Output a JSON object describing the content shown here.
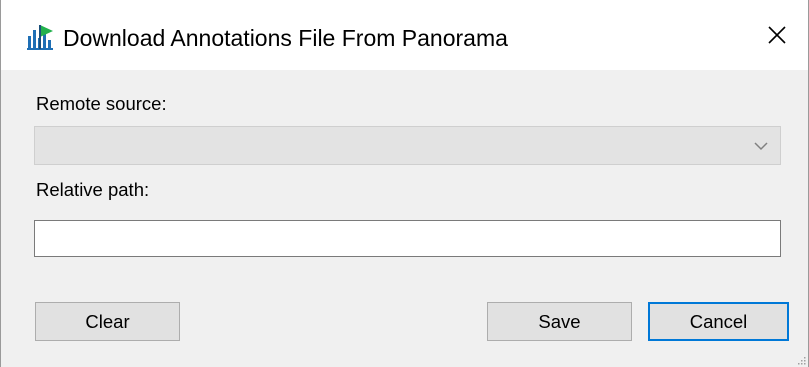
{
  "window": {
    "title": "Download Annotations File From Panorama",
    "app_icon": "skyline-app-icon",
    "close_icon": "close-icon"
  },
  "form": {
    "remote_source_label": "Remote source:",
    "remote_source_value": "",
    "relative_path_label": "Relative path:",
    "relative_path_value": "",
    "dropdown_icon": "chevron-down-icon"
  },
  "buttons": {
    "clear_label": "Clear",
    "save_label": "Save",
    "cancel_label": "Cancel"
  },
  "colors": {
    "accent": "#0078d7",
    "window_bg": "#f0f0f0",
    "disabled_combo_bg": "#e3e3e3",
    "button_bg": "#e1e1e1"
  }
}
